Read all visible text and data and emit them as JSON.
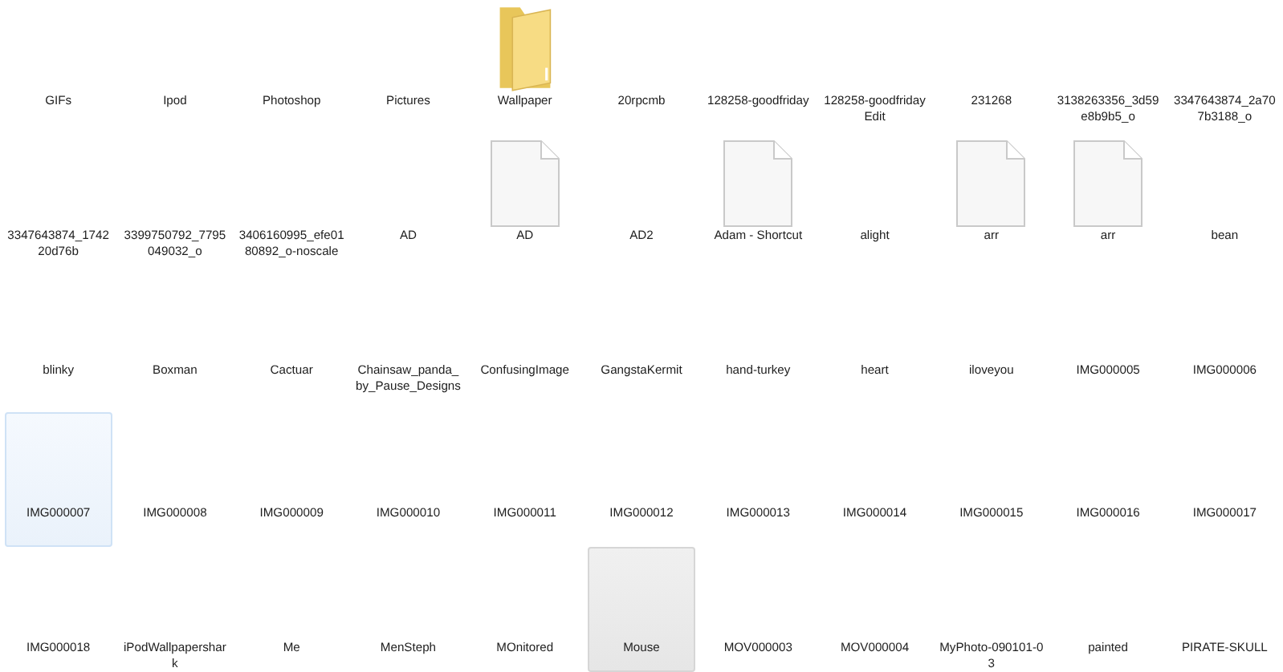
{
  "items": [
    {
      "label": "GIFs",
      "kind": "blank",
      "selected": false,
      "hovered": false
    },
    {
      "label": "Ipod",
      "kind": "blank",
      "selected": false,
      "hovered": false
    },
    {
      "label": "Photoshop",
      "kind": "blank",
      "selected": false,
      "hovered": false
    },
    {
      "label": "Pictures",
      "kind": "blank",
      "selected": false,
      "hovered": false
    },
    {
      "label": "Wallpaper",
      "kind": "folder",
      "selected": false,
      "hovered": false
    },
    {
      "label": "20rpcmb",
      "kind": "blank",
      "selected": false,
      "hovered": false
    },
    {
      "label": "128258-goodfriday",
      "kind": "blank",
      "selected": false,
      "hovered": false
    },
    {
      "label": "128258-goodfridayEdit",
      "kind": "blank",
      "selected": false,
      "hovered": false
    },
    {
      "label": "231268",
      "kind": "blank",
      "selected": false,
      "hovered": false
    },
    {
      "label": "3138263356_3d59e8b9b5_o",
      "kind": "blank",
      "selected": false,
      "hovered": false
    },
    {
      "label": "3347643874_2a707b3188_o",
      "kind": "blank",
      "selected": false,
      "hovered": false
    },
    {
      "label": "3347643874_174220d76b",
      "kind": "blank",
      "selected": false,
      "hovered": false
    },
    {
      "label": "3399750792_7795049032_o",
      "kind": "blank",
      "selected": false,
      "hovered": false
    },
    {
      "label": "3406160995_efe0180892_o-noscale",
      "kind": "blank",
      "selected": false,
      "hovered": false
    },
    {
      "label": "AD",
      "kind": "blank",
      "selected": false,
      "hovered": false
    },
    {
      "label": "AD",
      "kind": "document",
      "selected": false,
      "hovered": false
    },
    {
      "label": "AD2",
      "kind": "blank",
      "selected": false,
      "hovered": false
    },
    {
      "label": "Adam - Shortcut",
      "kind": "document",
      "selected": false,
      "hovered": false
    },
    {
      "label": "alight",
      "kind": "blank",
      "selected": false,
      "hovered": false
    },
    {
      "label": "arr",
      "kind": "document",
      "selected": false,
      "hovered": false
    },
    {
      "label": "arr",
      "kind": "document",
      "selected": false,
      "hovered": false
    },
    {
      "label": "bean",
      "kind": "blank",
      "selected": false,
      "hovered": false
    },
    {
      "label": "blinky",
      "kind": "blank",
      "selected": false,
      "hovered": false
    },
    {
      "label": "Boxman",
      "kind": "blank",
      "selected": false,
      "hovered": false
    },
    {
      "label": "Cactuar",
      "kind": "blank",
      "selected": false,
      "hovered": false
    },
    {
      "label": "Chainsaw_panda_by_Pause_Designs",
      "kind": "blank",
      "selected": false,
      "hovered": false
    },
    {
      "label": "ConfusingImage",
      "kind": "blank",
      "selected": false,
      "hovered": false
    },
    {
      "label": "GangstaKermit",
      "kind": "blank",
      "selected": false,
      "hovered": false
    },
    {
      "label": "hand-turkey",
      "kind": "blank",
      "selected": false,
      "hovered": false
    },
    {
      "label": "heart",
      "kind": "blank",
      "selected": false,
      "hovered": false
    },
    {
      "label": "iloveyou",
      "kind": "blank",
      "selected": false,
      "hovered": false
    },
    {
      "label": "IMG000005",
      "kind": "blank",
      "selected": false,
      "hovered": false
    },
    {
      "label": "IMG000006",
      "kind": "blank",
      "selected": false,
      "hovered": false
    },
    {
      "label": "IMG000007",
      "kind": "blank",
      "selected": false,
      "hovered": true
    },
    {
      "label": "IMG000008",
      "kind": "blank",
      "selected": false,
      "hovered": false
    },
    {
      "label": "IMG000009",
      "kind": "blank",
      "selected": false,
      "hovered": false
    },
    {
      "label": "IMG000010",
      "kind": "blank",
      "selected": false,
      "hovered": false
    },
    {
      "label": "IMG000011",
      "kind": "blank",
      "selected": false,
      "hovered": false
    },
    {
      "label": "IMG000012",
      "kind": "blank",
      "selected": false,
      "hovered": false
    },
    {
      "label": "IMG000013",
      "kind": "blank",
      "selected": false,
      "hovered": false
    },
    {
      "label": "IMG000014",
      "kind": "blank",
      "selected": false,
      "hovered": false
    },
    {
      "label": "IMG000015",
      "kind": "blank",
      "selected": false,
      "hovered": false
    },
    {
      "label": "IMG000016",
      "kind": "blank",
      "selected": false,
      "hovered": false
    },
    {
      "label": "IMG000017",
      "kind": "blank",
      "selected": false,
      "hovered": false
    },
    {
      "label": "IMG000018",
      "kind": "blank",
      "selected": false,
      "hovered": false
    },
    {
      "label": "iPodWallpapershark",
      "kind": "blank",
      "selected": false,
      "hovered": false
    },
    {
      "label": "Me",
      "kind": "blank",
      "selected": false,
      "hovered": false
    },
    {
      "label": "MenSteph",
      "kind": "blank",
      "selected": false,
      "hovered": false
    },
    {
      "label": "MOnitored",
      "kind": "blank",
      "selected": false,
      "hovered": false
    },
    {
      "label": "Mouse",
      "kind": "blank",
      "selected": true,
      "hovered": false
    },
    {
      "label": "MOV000003",
      "kind": "blank",
      "selected": false,
      "hovered": false
    },
    {
      "label": "MOV000004",
      "kind": "blank",
      "selected": false,
      "hovered": false
    },
    {
      "label": "MyPhoto-090101-03",
      "kind": "blank",
      "selected": false,
      "hovered": false
    },
    {
      "label": "painted",
      "kind": "blank",
      "selected": false,
      "hovered": false
    },
    {
      "label": "PIRATE-SKULL",
      "kind": "blank",
      "selected": false,
      "hovered": false
    }
  ]
}
